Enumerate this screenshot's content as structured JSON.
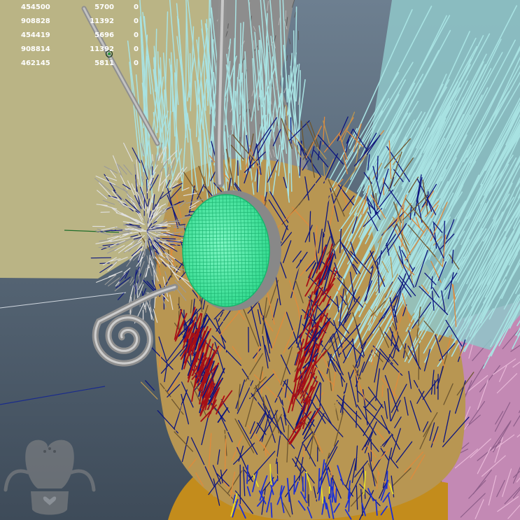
{
  "stats": {
    "rows": [
      [
        "454500",
        "5700",
        "0"
      ],
      [
        "908828",
        "11392",
        "0"
      ],
      [
        "454419",
        "5696",
        "0"
      ],
      [
        "908814",
        "11392",
        "0"
      ],
      [
        "462145",
        "5811",
        "0"
      ]
    ]
  },
  "scene": {
    "icons": {
      "pivot": "pivot-marker-icon",
      "logo": "mascot-logo-icon"
    },
    "colors": {
      "background_gray": "#596b80",
      "ground_yellow": "#bab485",
      "eye_mesh": "#46f0a2",
      "hair_white": "#e0e0e0",
      "hair_blue": "#0c157f",
      "hair_red": "#a60f17",
      "hair_orange": "#e08a3c",
      "hair_tan": "#b89652",
      "wing_cyan": "#a8e2e2",
      "wing_purple": "#c389b4",
      "body_gold": "#c38c1c",
      "antenna_gray": "#a1a1a1"
    }
  }
}
